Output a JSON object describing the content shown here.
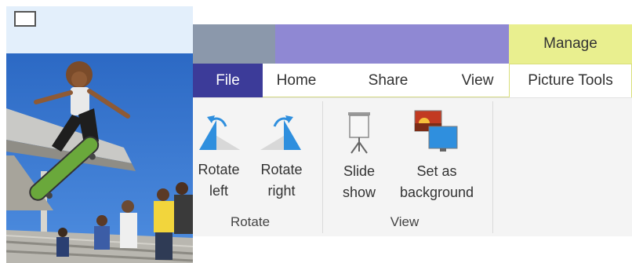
{
  "ribbon": {
    "contextual_header": "Manage",
    "tabs": [
      {
        "label": "File"
      },
      {
        "label": "Home"
      },
      {
        "label": "Share"
      },
      {
        "label": "View"
      },
      {
        "label": "Picture Tools"
      }
    ],
    "groups": {
      "rotate": {
        "label": "Rotate",
        "commands": [
          {
            "line1": "Rotate",
            "line2": "left",
            "icon": "rotate-left-icon"
          },
          {
            "line1": "Rotate",
            "line2": "right",
            "icon": "rotate-right-icon"
          }
        ]
      },
      "view": {
        "label": "View",
        "commands": [
          {
            "line1": "Slide",
            "line2": "show",
            "icon": "projector-screen-icon"
          },
          {
            "line1": "Set as",
            "line2": "background",
            "icon": "desktop-background-icon"
          }
        ]
      }
    }
  },
  "colors": {
    "file_tab": "#3c3b99",
    "title_strip": "#8f88d3",
    "contextual_tab": "#e9ef8f",
    "thumbnail_panel": "#e3effb",
    "ribbon_body": "#f4f4f4"
  }
}
